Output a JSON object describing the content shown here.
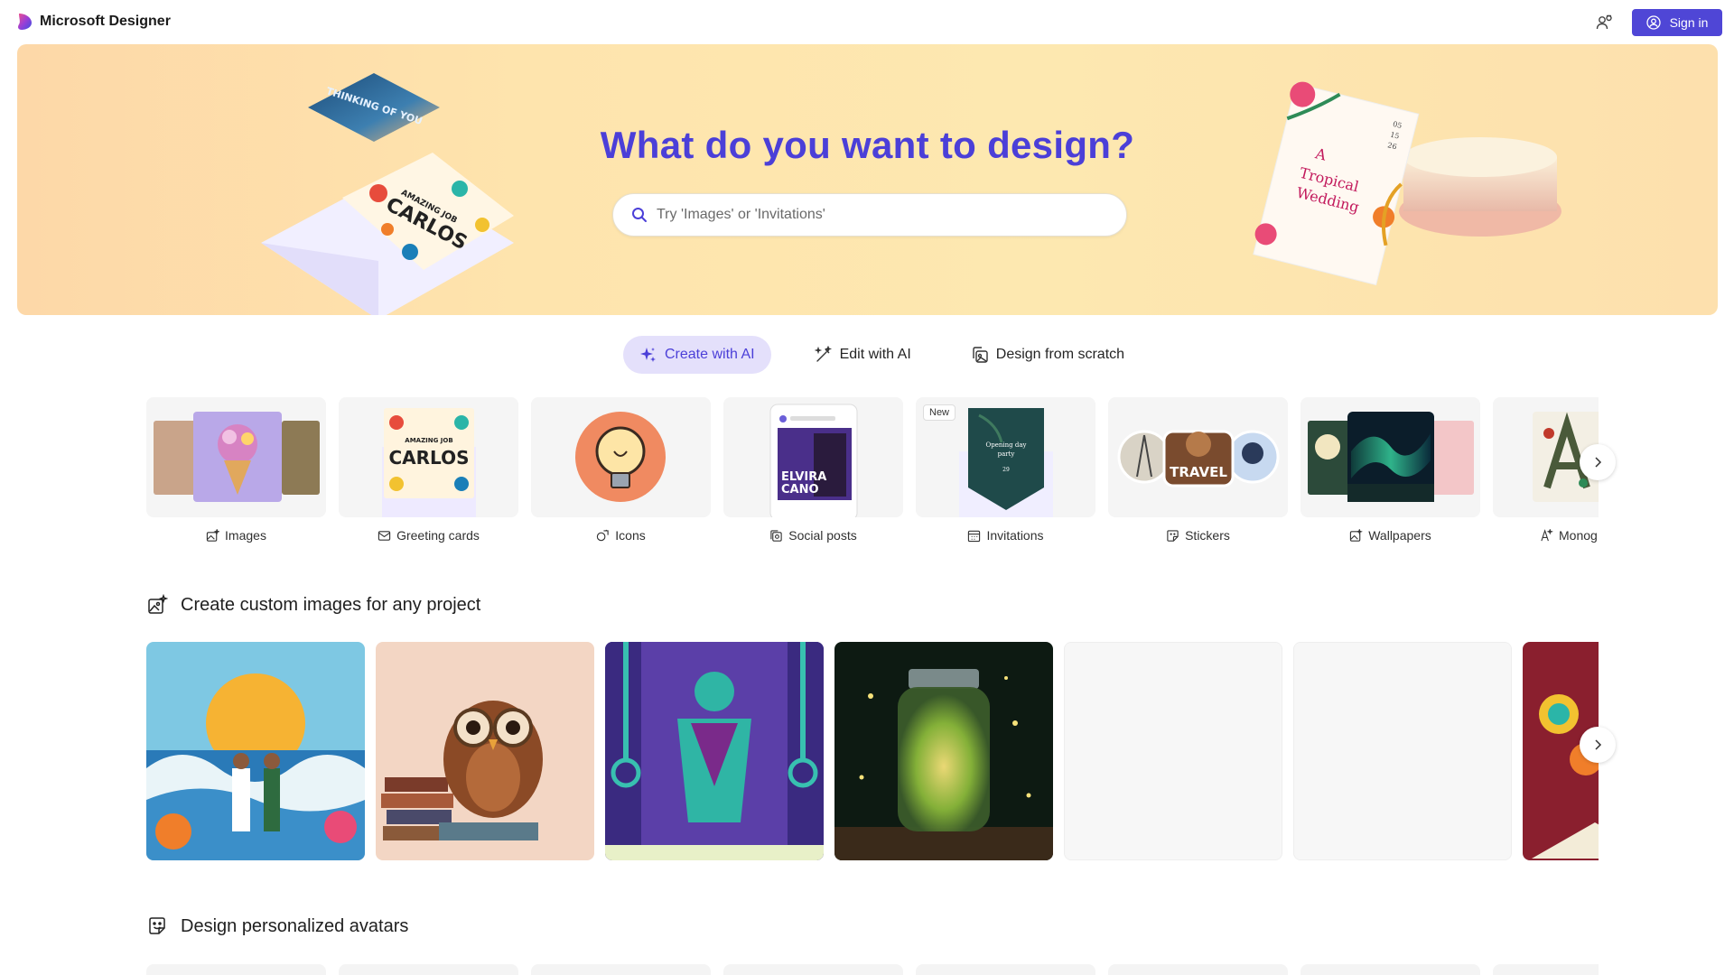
{
  "app": {
    "name": "Microsoft Designer",
    "signin_label": "Sign in"
  },
  "hero": {
    "title": "What do you want to design?",
    "search_placeholder": "Try 'Images' or 'Invitations'",
    "deco_card_text": "THINKING OF YOU",
    "deco_envelope_text": [
      "AMAZING JOB",
      "CARLOS"
    ],
    "deco_wedding_text": [
      "A",
      "Tropical",
      "Wedding"
    ],
    "deco_wedding_date": [
      "05",
      "15",
      "26"
    ]
  },
  "tabs": [
    {
      "label": "Create with AI",
      "active": true,
      "icon": "sparkle-icon"
    },
    {
      "label": "Edit with AI",
      "active": false,
      "icon": "magic-wand-icon"
    },
    {
      "label": "Design from scratch",
      "active": false,
      "icon": "design-icon"
    }
  ],
  "categories": [
    {
      "label": "Images",
      "icon": "image-sparkle-icon"
    },
    {
      "label": "Greeting cards",
      "icon": "envelope-icon",
      "thumb_text": [
        "AMAZING JOB",
        "CARLOS"
      ]
    },
    {
      "label": "Icons",
      "icon": "icon-shapes-icon"
    },
    {
      "label": "Social posts",
      "icon": "social-post-icon",
      "thumb_text": [
        "ELVIRA",
        "CANO"
      ]
    },
    {
      "label": "Invitations",
      "icon": "calendar-icon",
      "badge": "New",
      "thumb_text": [
        "Opening day",
        "party",
        "29"
      ]
    },
    {
      "label": "Stickers",
      "icon": "sticker-icon",
      "thumb_text": "TRAVEL"
    },
    {
      "label": "Wallpapers",
      "icon": "wallpaper-icon"
    },
    {
      "label": "Monog",
      "icon": "monogram-icon"
    }
  ],
  "sections": {
    "images_heading": "Create custom images for any project",
    "avatars_heading": "Design personalized avatars"
  },
  "colors": {
    "accent": "#4f46d6",
    "title": "#4b3fd8",
    "active_tab_bg": "#e4e0fb"
  }
}
